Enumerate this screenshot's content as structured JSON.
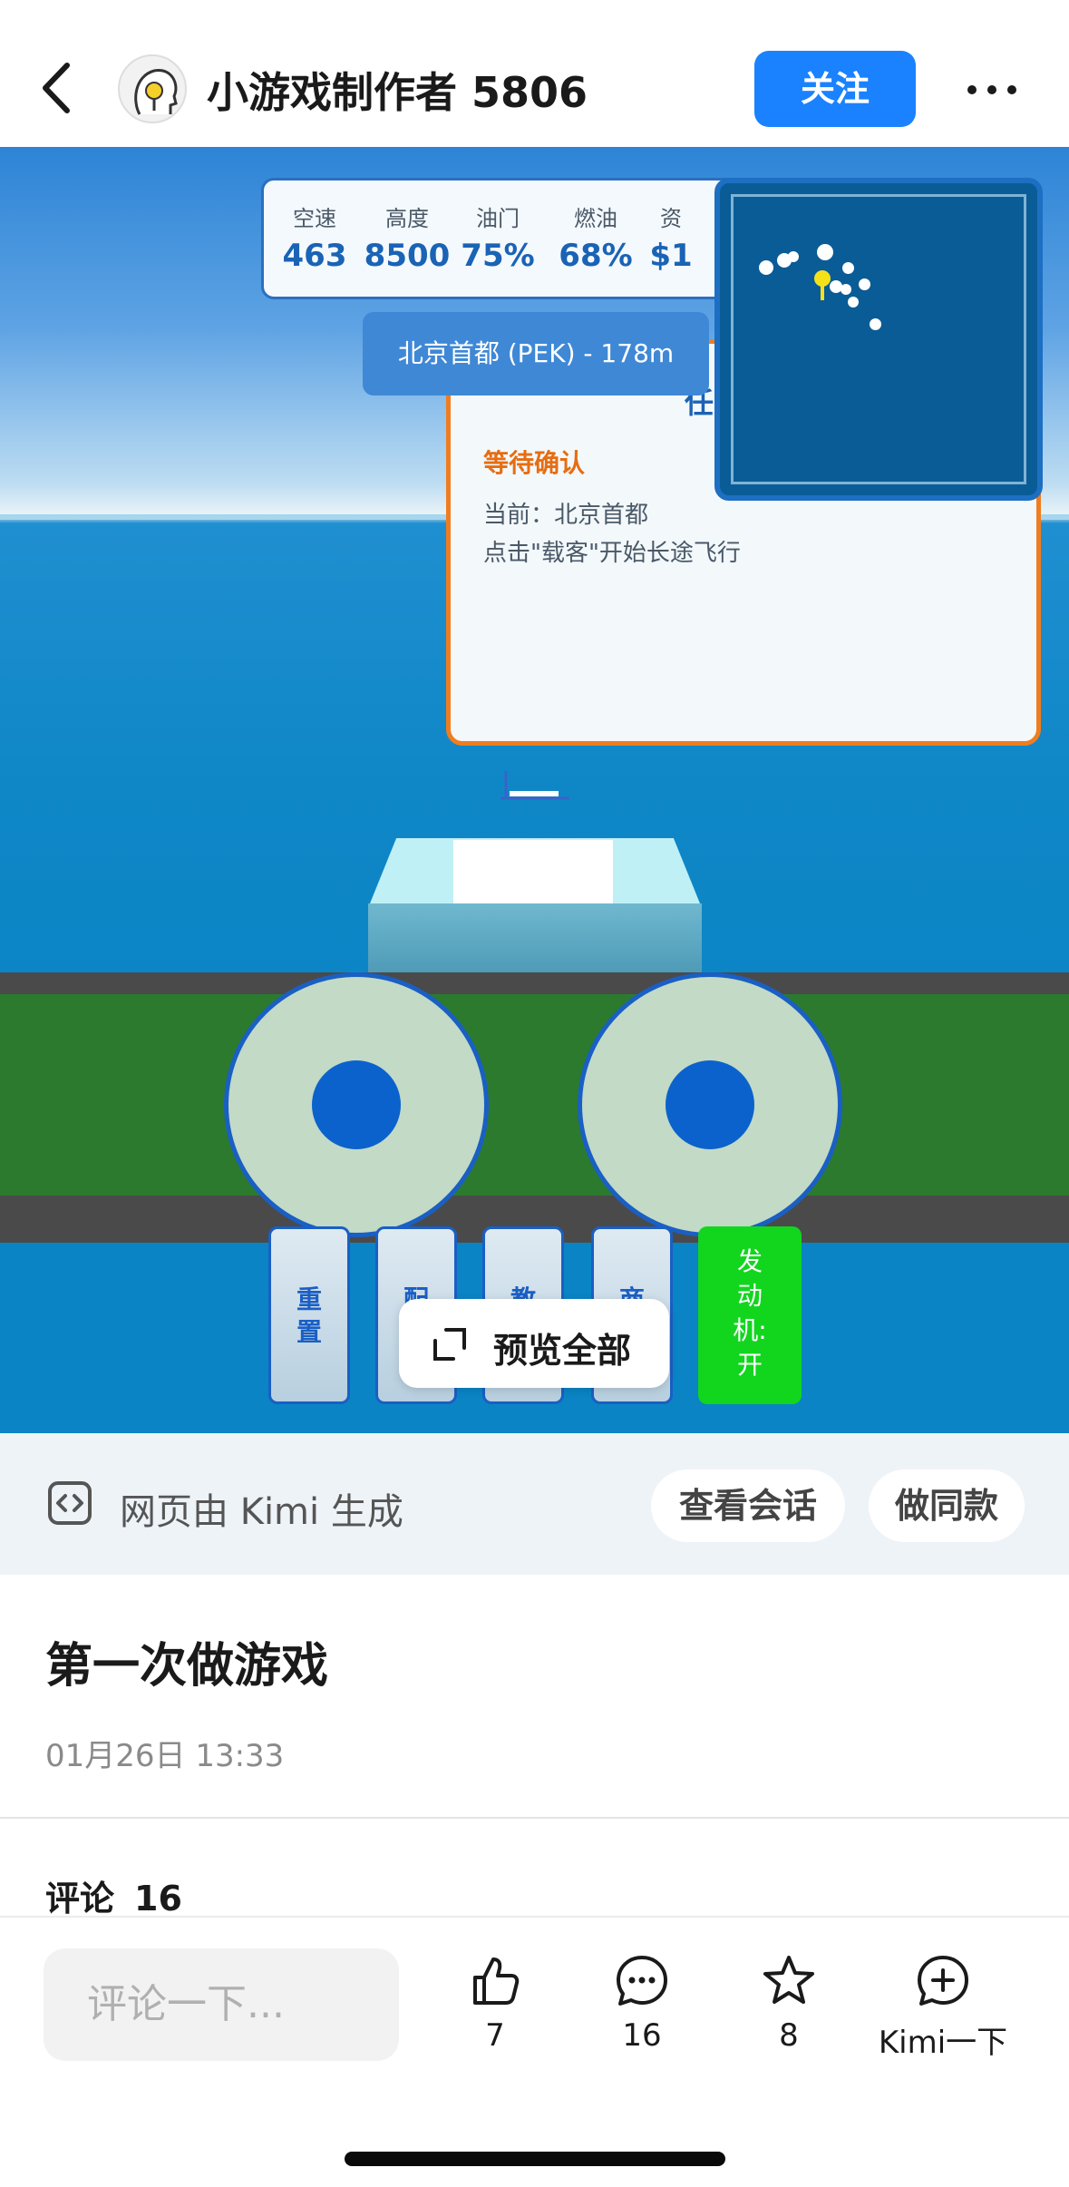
{
  "header": {
    "author_name": "小游戏制作者 5806",
    "follow_label": "关注"
  },
  "game": {
    "hud": [
      {
        "label": "空速",
        "value": "463"
      },
      {
        "label": "高度",
        "value": "8500"
      },
      {
        "label": "油门",
        "value": "75%"
      },
      {
        "label": "燃油",
        "value": "68%"
      },
      {
        "label": "资",
        "value": "$1"
      }
    ],
    "destination": "北京首都 (PEK) - 178m",
    "mission": {
      "title": "任",
      "status": "等待确认",
      "current": "当前：北京首都",
      "hint": "点击\"载客\"开始长途飞行"
    },
    "controls": [
      {
        "line1": "重",
        "line2": "置"
      },
      {
        "line1": "配",
        "line2": ""
      },
      {
        "line1": "教",
        "line2": ""
      },
      {
        "line1": "商",
        "line2": ""
      }
    ],
    "engine": {
      "line1": "发",
      "line2": "动",
      "line3": "机:",
      "line4": "开"
    },
    "preview_label": "预览全部"
  },
  "kimi_bar": {
    "generated_by": "网页由 Kimi 生成",
    "view_chat": "查看会话",
    "make_same": "做同款"
  },
  "post": {
    "title": "第一次做游戏",
    "time": "01月26日 13:33",
    "comments_label": "评论",
    "comments_count": "16"
  },
  "bottom_bar": {
    "comment_placeholder": "评论一下...",
    "likes": "7",
    "comments": "16",
    "favorites": "8",
    "kimi_label": "Kimi一下"
  },
  "colors": {
    "accent": "#1a82ff",
    "mission_border": "#f07d1f",
    "engine_on": "#12d61e"
  }
}
